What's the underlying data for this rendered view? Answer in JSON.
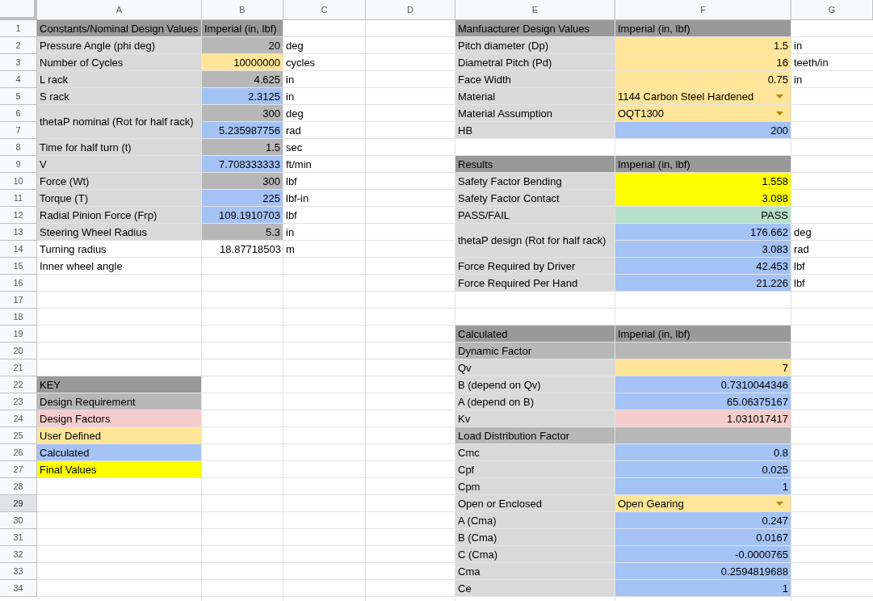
{
  "columns": [
    "A",
    "B",
    "C",
    "D",
    "E",
    "F",
    "G"
  ],
  "rows": [
    {
      "number": "1",
      "selected": false,
      "cells": [
        {
          "text": "Constants/Nominal Design Values",
          "kind": "header"
        },
        {
          "text": "Imperial (in, lbf)",
          "kind": "header"
        },
        {},
        {},
        {
          "text": "Manfuacturer Design Values",
          "kind": "header"
        },
        {
          "text": "Imperial (in, lbf)",
          "kind": "header"
        },
        {}
      ]
    },
    {
      "number": "2",
      "selected": false,
      "cells": [
        {
          "text": "Pressure Angle (phi deg)",
          "kind": "label"
        },
        {
          "text": "20",
          "kind": "requirement",
          "numeric": true
        },
        {
          "text": "deg"
        },
        {},
        {
          "text": "Pitch diameter (Dp)",
          "kind": "label"
        },
        {
          "text": "1.5",
          "kind": "user",
          "numeric": true
        },
        {
          "text": "in"
        }
      ]
    },
    {
      "number": "3",
      "selected": false,
      "cells": [
        {
          "text": "Number of Cycles",
          "kind": "label"
        },
        {
          "text": "10000000",
          "kind": "user",
          "numeric": true
        },
        {
          "text": "cycles"
        },
        {},
        {
          "text": "Diametral Pitch (Pd)",
          "kind": "label"
        },
        {
          "text": "16",
          "kind": "user",
          "numeric": true
        },
        {
          "text": "teeth/in"
        }
      ]
    },
    {
      "number": "4",
      "selected": false,
      "cells": [
        {
          "text": "L rack",
          "kind": "label"
        },
        {
          "text": "4.625",
          "kind": "requirement",
          "numeric": true
        },
        {
          "text": "in"
        },
        {},
        {
          "text": "Face Width",
          "kind": "label"
        },
        {
          "text": "0.75",
          "kind": "user",
          "numeric": true
        },
        {
          "text": "in"
        }
      ]
    },
    {
      "number": "5",
      "selected": false,
      "cells": [
        {
          "text": "S rack",
          "kind": "label"
        },
        {
          "text": "2.3125",
          "kind": "calculated",
          "numeric": true
        },
        {
          "text": "in"
        },
        {},
        {
          "text": "Material",
          "kind": "label"
        },
        {
          "text": "1144 Carbon Steel Hardened",
          "kind": "user",
          "dropdown": true
        },
        {}
      ]
    },
    {
      "number": "6",
      "selected": false,
      "cells": [
        {
          "text": "thetaP nominal (Rot for half rack)",
          "kind": "label",
          "merged": true
        },
        {
          "text": "300",
          "kind": "requirement",
          "numeric": true
        },
        {
          "text": "deg"
        },
        {},
        {
          "text": "Material Assumption",
          "kind": "label"
        },
        {
          "text": "OQT1300",
          "kind": "user",
          "dropdown": true
        },
        {}
      ]
    },
    {
      "number": "7",
      "selected": false,
      "cells": [
        {},
        {
          "text": "5.235987756",
          "kind": "calculated",
          "numeric": true
        },
        {
          "text": "rad"
        },
        {},
        {
          "text": "HB",
          "kind": "label"
        },
        {
          "text": "200",
          "kind": "calculated",
          "numeric": true
        },
        {}
      ]
    },
    {
      "number": "8",
      "selected": false,
      "cells": [
        {
          "text": "Time for half turn (t)",
          "kind": "label"
        },
        {
          "text": "1.5",
          "kind": "requirement",
          "numeric": true
        },
        {
          "text": "sec"
        },
        {},
        {},
        {},
        {}
      ]
    },
    {
      "number": "9",
      "selected": false,
      "cells": [
        {
          "text": "V",
          "kind": "label"
        },
        {
          "text": "7.708333333",
          "kind": "calculated",
          "numeric": true
        },
        {
          "text": "ft/min"
        },
        {},
        {
          "text": "Results",
          "kind": "header"
        },
        {
          "text": "Imperial (in, lbf)",
          "kind": "header"
        },
        {}
      ]
    },
    {
      "number": "10",
      "selected": false,
      "cells": [
        {
          "text": "Force (Wt)",
          "kind": "label"
        },
        {
          "text": "300",
          "kind": "requirement",
          "numeric": true
        },
        {
          "text": "lbf"
        },
        {},
        {
          "text": "Safety Factor Bending",
          "kind": "label"
        },
        {
          "text": "1.558",
          "kind": "final",
          "numeric": true
        },
        {}
      ]
    },
    {
      "number": "11",
      "selected": false,
      "cells": [
        {
          "text": "Torque (T)",
          "kind": "label"
        },
        {
          "text": "225",
          "kind": "calculated",
          "numeric": true
        },
        {
          "text": "lbf-in"
        },
        {},
        {
          "text": "Safety Factor Contact",
          "kind": "label"
        },
        {
          "text": "3.088",
          "kind": "final",
          "numeric": true
        },
        {}
      ]
    },
    {
      "number": "12",
      "selected": false,
      "cells": [
        {
          "text": "Radial Pinion Force (Frp)",
          "kind": "label"
        },
        {
          "text": "109.1910703",
          "kind": "calculated",
          "numeric": true
        },
        {
          "text": "lbf"
        },
        {},
        {
          "text": "PASS/FAIL",
          "kind": "label"
        },
        {
          "text": "PASS",
          "kind": "pass",
          "numeric": true
        },
        {}
      ]
    },
    {
      "number": "13",
      "selected": false,
      "cells": [
        {
          "text": "Steering Wheel Radius",
          "kind": "label"
        },
        {
          "text": "5.3",
          "kind": "requirement",
          "numeric": true
        },
        {
          "text": "in"
        },
        {},
        {
          "text": "thetaP design (Rot for half rack)",
          "kind": "label",
          "merged": true
        },
        {
          "text": "176.662",
          "kind": "calculated",
          "numeric": true
        },
        {
          "text": "deg"
        }
      ]
    },
    {
      "number": "14",
      "selected": false,
      "cells": [
        {
          "text": "Turning radius"
        },
        {
          "text": "18.87718503",
          "numeric": true
        },
        {
          "text": "m"
        },
        {},
        {},
        {
          "text": "3.083",
          "kind": "calculated",
          "numeric": true
        },
        {
          "text": "rad"
        }
      ]
    },
    {
      "number": "15",
      "selected": false,
      "cells": [
        {
          "text": "Inner wheel angle"
        },
        {},
        {},
        {},
        {
          "text": "Force Required by Driver",
          "kind": "label"
        },
        {
          "text": "42.453",
          "kind": "calculated",
          "numeric": true
        },
        {
          "text": "lbf"
        }
      ]
    },
    {
      "number": "16",
      "selected": false,
      "cells": [
        {},
        {},
        {},
        {},
        {
          "text": "Force Required Per Hand",
          "kind": "label"
        },
        {
          "text": "21.226",
          "kind": "calculated",
          "numeric": true
        },
        {
          "text": "lbf"
        }
      ]
    },
    {
      "number": "17",
      "selected": false,
      "cells": [
        {},
        {},
        {},
        {},
        {},
        {},
        {}
      ]
    },
    {
      "number": "18",
      "selected": false,
      "cells": [
        {},
        {},
        {},
        {},
        {},
        {},
        {}
      ]
    },
    {
      "number": "19",
      "selected": false,
      "cells": [
        {},
        {},
        {},
        {},
        {
          "text": "Calculated",
          "kind": "header"
        },
        {
          "text": "Imperial (in, lbf)",
          "kind": "header"
        },
        {}
      ]
    },
    {
      "number": "20",
      "selected": false,
      "cells": [
        {},
        {},
        {},
        {},
        {
          "text": "Dynamic Factor",
          "kind": "requirement"
        },
        {
          "kind": "requirement"
        },
        {}
      ]
    },
    {
      "number": "21",
      "selected": false,
      "cells": [
        {},
        {},
        {},
        {},
        {
          "text": "Qv",
          "kind": "label"
        },
        {
          "text": "7",
          "kind": "user",
          "numeric": true
        },
        {}
      ]
    },
    {
      "number": "22",
      "selected": false,
      "cells": [
        {
          "text": "KEY",
          "kind": "header"
        },
        {},
        {},
        {},
        {
          "text": "B (depend on Qv)",
          "kind": "label"
        },
        {
          "text": "0.7310044346",
          "kind": "calculated",
          "numeric": true
        },
        {}
      ]
    },
    {
      "number": "23",
      "selected": false,
      "cells": [
        {
          "text": "Design Requirement",
          "kind": "requirement"
        },
        {},
        {},
        {},
        {
          "text": "A (depend on B)",
          "kind": "label"
        },
        {
          "text": "65.06375167",
          "kind": "calculated",
          "numeric": true
        },
        {}
      ]
    },
    {
      "number": "24",
      "selected": false,
      "cells": [
        {
          "text": "Design Factors",
          "kind": "factor"
        },
        {},
        {},
        {},
        {
          "text": "Kv",
          "kind": "label"
        },
        {
          "text": "1.031017417",
          "kind": "factor",
          "numeric": true
        },
        {}
      ]
    },
    {
      "number": "25",
      "selected": false,
      "cells": [
        {
          "text": "User Defined",
          "kind": "user"
        },
        {},
        {},
        {},
        {
          "text": "Load Distribution Factor",
          "kind": "requirement"
        },
        {
          "kind": "requirement"
        },
        {}
      ]
    },
    {
      "number": "26",
      "selected": false,
      "cells": [
        {
          "text": "Calculated",
          "kind": "calculated"
        },
        {},
        {},
        {},
        {
          "text": "Cmc",
          "kind": "label"
        },
        {
          "text": "0.8",
          "kind": "calculated",
          "numeric": true
        },
        {}
      ]
    },
    {
      "number": "27",
      "selected": false,
      "cells": [
        {
          "text": "Final Values",
          "kind": "final"
        },
        {},
        {},
        {},
        {
          "text": "Cpf",
          "kind": "label"
        },
        {
          "text": "0.025",
          "kind": "calculated",
          "numeric": true
        },
        {}
      ]
    },
    {
      "number": "28",
      "selected": false,
      "cells": [
        {},
        {},
        {},
        {},
        {
          "text": "Cpm",
          "kind": "label"
        },
        {
          "text": "1",
          "kind": "calculated",
          "numeric": true
        },
        {}
      ]
    },
    {
      "number": "29",
      "selected": true,
      "cells": [
        {},
        {},
        {},
        {},
        {
          "text": "Open or Enclosed",
          "kind": "label"
        },
        {
          "text": "Open Gearing",
          "kind": "user",
          "dropdown": true
        },
        {}
      ]
    },
    {
      "number": "30",
      "selected": false,
      "cells": [
        {},
        {},
        {},
        {},
        {
          "text": "A (Cma)",
          "kind": "label"
        },
        {
          "text": "0.247",
          "kind": "calculated",
          "numeric": true
        },
        {}
      ]
    },
    {
      "number": "31",
      "selected": false,
      "cells": [
        {},
        {},
        {},
        {},
        {
          "text": "B (Cma)",
          "kind": "label"
        },
        {
          "text": "0.0167",
          "kind": "calculated",
          "numeric": true
        },
        {}
      ]
    },
    {
      "number": "32",
      "selected": false,
      "cells": [
        {},
        {},
        {},
        {},
        {
          "text": "C (Cma)",
          "kind": "label"
        },
        {
          "text": "-0.0000765",
          "kind": "calculated",
          "numeric": true
        },
        {}
      ]
    },
    {
      "number": "33",
      "selected": false,
      "cells": [
        {},
        {},
        {},
        {},
        {
          "text": "Cma",
          "kind": "label"
        },
        {
          "text": "0.2594819688",
          "kind": "calculated",
          "numeric": true
        },
        {}
      ]
    },
    {
      "number": "34",
      "selected": false,
      "cells": [
        {},
        {},
        {},
        {},
        {
          "text": "Ce",
          "kind": "label"
        },
        {
          "text": "1",
          "kind": "calculated",
          "numeric": true
        },
        {}
      ]
    }
  ]
}
